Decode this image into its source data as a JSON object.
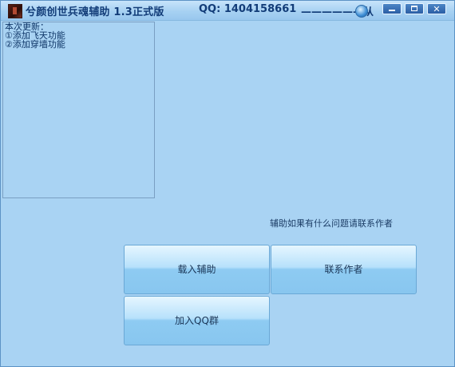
{
  "window": {
    "title": "兮颜创世兵魂辅助 1.3正式版",
    "qq": "QQ: 1404158661",
    "author": "——————从",
    "author_suffix": "."
  },
  "icons": {
    "app": "app-icon",
    "author": "avatar-icon",
    "minimize": "minimize-icon",
    "maximize": "maximize-icon",
    "close": "close-icon"
  },
  "window_controls": {
    "close_glyph": "✕"
  },
  "update_box": {
    "heading": "本次更新：",
    "items": [
      "①添加飞天功能",
      "②添加穿墙功能"
    ]
  },
  "notice": "辅助如果有什么问题请联系作者",
  "buttons": {
    "load": "载入辅助",
    "contact": "联系作者",
    "join": "加入QQ群"
  },
  "colors": {
    "background": "#a9d3f3",
    "title_text": "#123c78",
    "button_gradient_top": "#e6f6ff",
    "button_gradient_bottom": "#88c6ef"
  }
}
